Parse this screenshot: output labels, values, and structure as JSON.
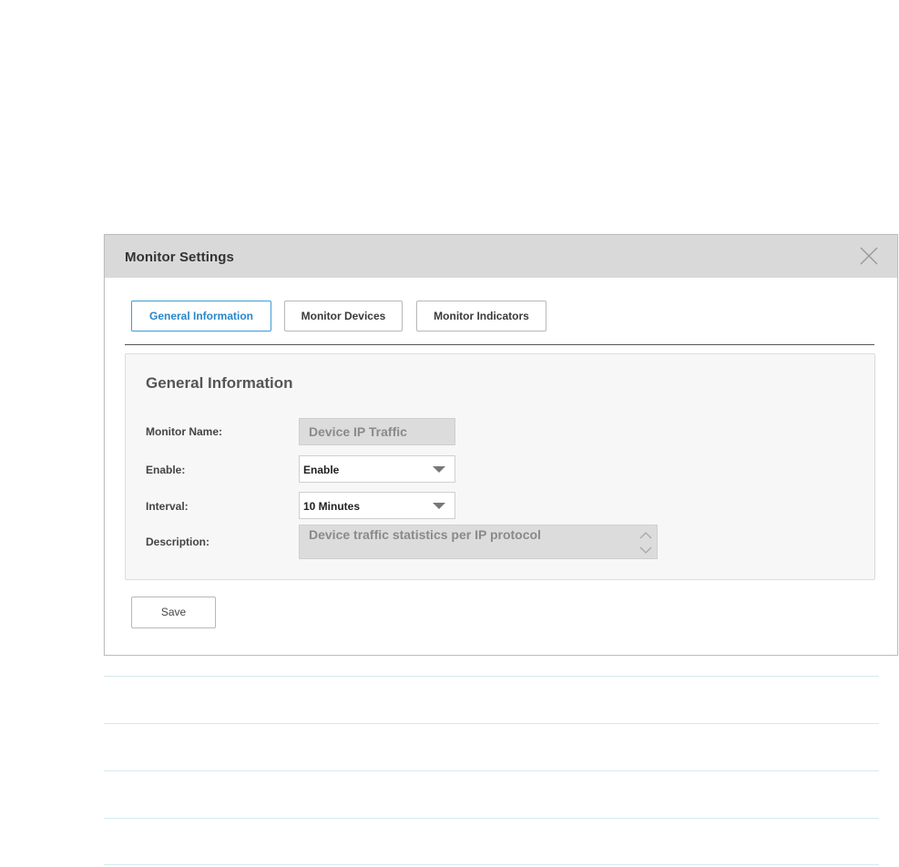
{
  "dialog": {
    "title": "Monitor Settings",
    "close_icon": "close-icon"
  },
  "tabs": [
    {
      "label": "General Information",
      "active": true
    },
    {
      "label": "Monitor Devices",
      "active": false
    },
    {
      "label": "Monitor Indicators",
      "active": false
    }
  ],
  "panel": {
    "title": "General Information",
    "fields": {
      "monitor_name": {
        "label": "Monitor Name:",
        "value": "Device IP Traffic"
      },
      "enable": {
        "label": "Enable:",
        "value": "Enable"
      },
      "interval": {
        "label": "Interval:",
        "value": "10 Minutes"
      },
      "description": {
        "label": "Description:",
        "value": "Device traffic statistics per IP protocol"
      }
    }
  },
  "actions": {
    "save_label": "Save"
  },
  "colors": {
    "accent": "#2a87c9",
    "header_bg": "#d9d9d9",
    "separator": "#d5e9f0"
  }
}
